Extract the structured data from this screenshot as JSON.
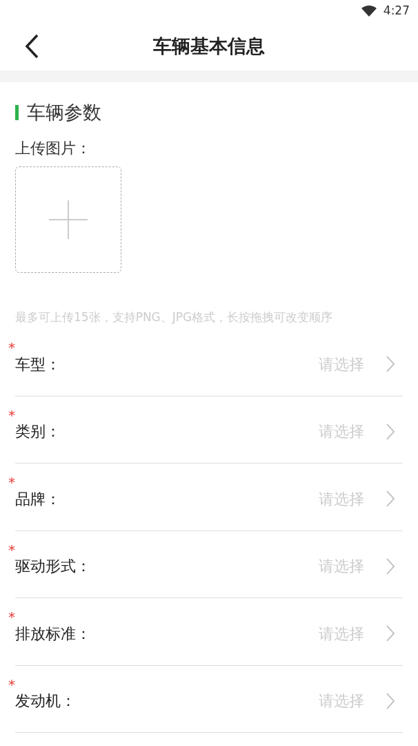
{
  "status_bar": {
    "time": "4:27"
  },
  "header": {
    "title": "车辆基本信息"
  },
  "section": {
    "title": "车辆参数"
  },
  "upload": {
    "label": "上传图片：",
    "hint": "最多可上传15张，支持PNG、JPG格式，长按拖拽可改变顺序"
  },
  "fields": [
    {
      "required_mark": "*",
      "label": "车型：",
      "placeholder": "请选择"
    },
    {
      "required_mark": "*",
      "label": "类别：",
      "placeholder": "请选择"
    },
    {
      "required_mark": "*",
      "label": "品牌：",
      "placeholder": "请选择"
    },
    {
      "required_mark": "*",
      "label": "驱动形式：",
      "placeholder": "请选择"
    },
    {
      "required_mark": "*",
      "label": "排放标准：",
      "placeholder": "请选择"
    },
    {
      "required_mark": "*",
      "label": "发动机：",
      "placeholder": "请选择"
    }
  ]
}
